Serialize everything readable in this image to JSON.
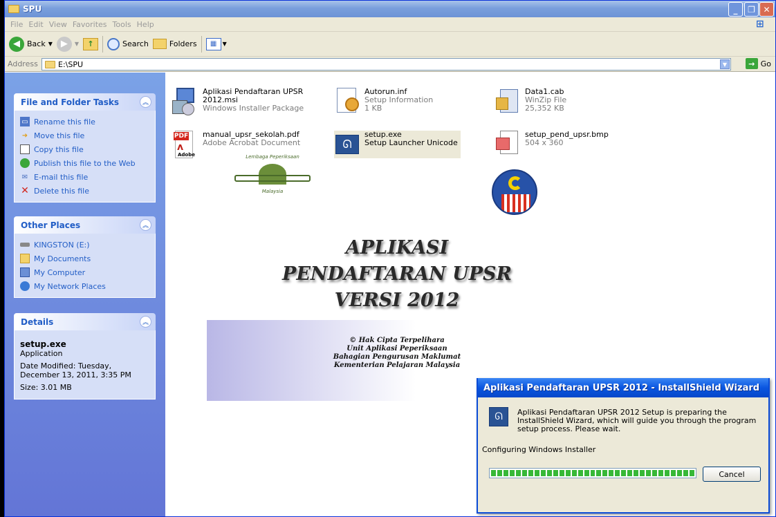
{
  "window": {
    "title": "SPU"
  },
  "menu": [
    "File",
    "Edit",
    "View",
    "Favorites",
    "Tools",
    "Help"
  ],
  "toolbar": {
    "back": "Back",
    "search": "Search",
    "folders": "Folders"
  },
  "address": {
    "label": "Address",
    "path": "E:\\SPU",
    "go": "Go"
  },
  "sidebar": {
    "file_tasks": {
      "title": "File and Folder Tasks",
      "items": [
        "Rename this file",
        "Move this file",
        "Copy this file",
        "Publish this file to the Web",
        "E-mail this file",
        "Delete this file"
      ]
    },
    "other_places": {
      "title": "Other Places",
      "items": [
        "KINGSTON (E:)",
        "My Documents",
        "My Computer",
        "My Network Places"
      ]
    },
    "details": {
      "title": "Details",
      "name": "setup.exe",
      "type": "Application",
      "modified_1": "Date Modified: Tuesday,",
      "modified_2": "December 13, 2011, 3:35 PM",
      "size": "Size: 3.01 MB"
    }
  },
  "files": [
    {
      "name1": "Aplikasi Pendaftaran UPSR",
      "name2": "2012.msi",
      "desc": "Windows Installer Package"
    },
    {
      "name1": "Autorun.inf",
      "name2": "Setup Information",
      "desc": "1 KB"
    },
    {
      "name1": "Data1.cab",
      "name2": "WinZip File",
      "desc": "25,352 KB"
    },
    {
      "name1": "manual_upsr_sekolah.pdf",
      "name2": "Adobe Acrobat Document",
      "desc": ""
    },
    {
      "name1": "setup.exe",
      "name2": "Setup Launcher Unicode",
      "desc": ""
    },
    {
      "name1": "setup_pend_upsr.bmp",
      "name2": "504 x 360",
      "desc": ""
    }
  ],
  "file_icons": {
    "pdf_label": "PDF",
    "pdf_brand": "Adobe"
  },
  "banner": {
    "line1": "APLIKASI",
    "line2": "PENDAFTARAN UPSR",
    "line3": "VERSI 2012",
    "copy1": "© Hak Cipta Terpelihara",
    "copy2": "Unit Aplikasi Peperiksaan",
    "copy3": "Bahagian Pengurusan Maklumat",
    "copy4": "Kementerian Pelajaran Malaysia",
    "logo_text_top": "Lembaga Peperiksaan",
    "logo_text_bottom": "Malaysia"
  },
  "dialog": {
    "title": "Aplikasi Pendaftaran UPSR 2012 - InstallShield Wizard",
    "message": "Aplikasi Pendaftaran UPSR 2012 Setup is preparing the InstallShield Wizard, which will guide you through the program setup process.  Please wait.",
    "status": "Configuring Windows Installer",
    "progress": 1.0,
    "cancel": "Cancel"
  }
}
